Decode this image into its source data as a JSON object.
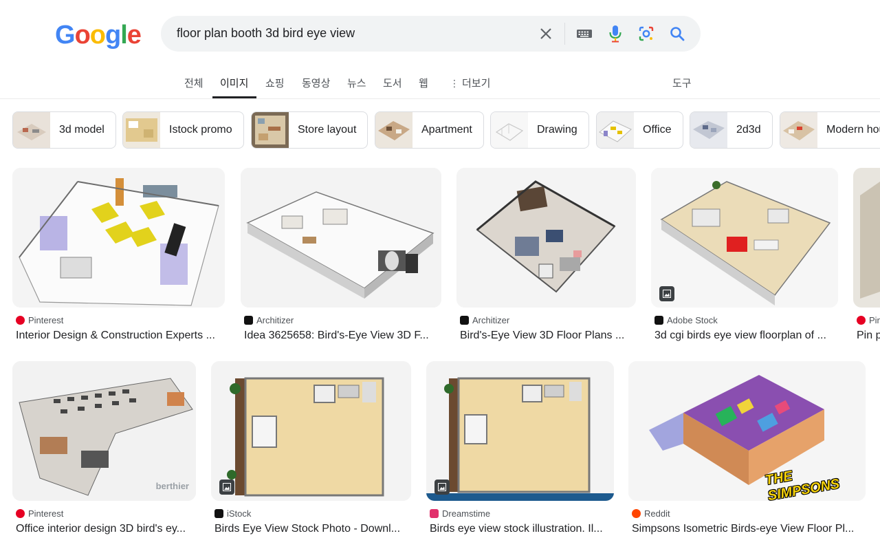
{
  "logo": {
    "letters": [
      "G",
      "o",
      "o",
      "g",
      "l",
      "e"
    ],
    "colors": [
      "#4285F4",
      "#EA4335",
      "#FBBC05",
      "#4285F4",
      "#34A853",
      "#EA4335"
    ]
  },
  "search": {
    "query": "floor plan booth 3d bird eye view"
  },
  "icons": {
    "clear": "close-icon",
    "keyboard": "keyboard-icon",
    "voice": "microphone-icon",
    "lens": "camera-lens-icon",
    "search": "search-icon"
  },
  "tabs": [
    {
      "label": "전체"
    },
    {
      "label": "이미지",
      "active": true
    },
    {
      "label": "쇼핑"
    },
    {
      "label": "동영상"
    },
    {
      "label": "뉴스"
    },
    {
      "label": "도서"
    },
    {
      "label": "웹"
    },
    {
      "label": "더보기"
    }
  ],
  "tools_label": "도구",
  "chips": [
    {
      "label": "3d model"
    },
    {
      "label": "Istock promo"
    },
    {
      "label": "Store layout"
    },
    {
      "label": "Apartment"
    },
    {
      "label": "Drawing"
    },
    {
      "label": "Office"
    },
    {
      "label": "2d3d"
    },
    {
      "label": "Modern house"
    }
  ],
  "results": [
    {
      "source": "Pinterest",
      "title": "Interior Design & Construction Experts ...",
      "favicon_color": "#E60023"
    },
    {
      "source": "Architizer",
      "title": "Idea 3625658: Bird's-Eye View 3D F...",
      "favicon_color": "#111111"
    },
    {
      "source": "Architizer",
      "title": "Bird's-Eye View 3D Floor Plans ...",
      "favicon_color": "#111111"
    },
    {
      "source": "Adobe Stock",
      "title": "3d cgi birds eye view floorplan of ...",
      "favicon_color": "#111111"
    },
    {
      "source": "Pinterest",
      "title": "Pin p",
      "favicon_color": "#E60023"
    },
    {
      "source": "Pinterest",
      "title": "Office interior design 3D bird's ey...",
      "favicon_color": "#E60023"
    },
    {
      "source": "iStock",
      "title": "Birds Eye View Stock Photo - Downl...",
      "favicon_color": "#111111"
    },
    {
      "source": "Dreamstime",
      "title": "Birds eye view stock illustration. Il...",
      "favicon_color": "#E1306C"
    },
    {
      "source": "Reddit",
      "title": "Simpsons Isometric Birds-eye View Floor Pl...",
      "favicon_color": "#FF4500"
    }
  ],
  "watermarks": {
    "berthier": "berthier",
    "simpsons": "THE SIMPSONS"
  }
}
